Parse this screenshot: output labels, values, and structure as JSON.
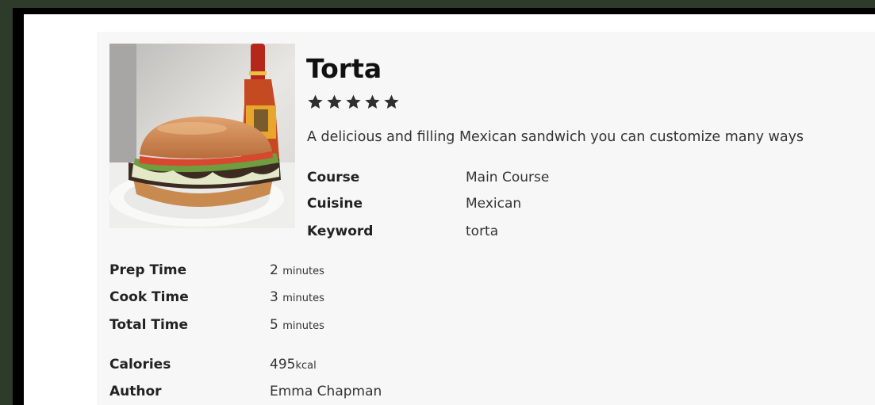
{
  "recipe": {
    "title": "Torta",
    "rating": 5,
    "summary": "A delicious and filling Mexican sandwich you can customize many ways",
    "meta": [
      {
        "label": "Course",
        "value": "Main Course"
      },
      {
        "label": "Cuisine",
        "value": "Mexican"
      },
      {
        "label": "Keyword",
        "value": "torta"
      }
    ],
    "times": [
      {
        "label": "Prep Time",
        "value": "2",
        "unit": "minutes"
      },
      {
        "label": "Cook Time",
        "value": "3",
        "unit": "minutes"
      },
      {
        "label": "Total Time",
        "value": "5",
        "unit": "minutes"
      }
    ],
    "calories": {
      "label": "Calories",
      "value": "495",
      "unit": "kcal"
    },
    "author": {
      "label": "Author",
      "value": "Emma Chapman"
    }
  },
  "colors": {
    "outer_background": "#2e3b2b",
    "frame": "#000000",
    "page": "#ffffff",
    "card": "#f7f7f7",
    "star": "#2f2f2f"
  },
  "icons": {
    "rating_star": "star-icon",
    "recipe_photo": "torta-sandwich-photo"
  }
}
